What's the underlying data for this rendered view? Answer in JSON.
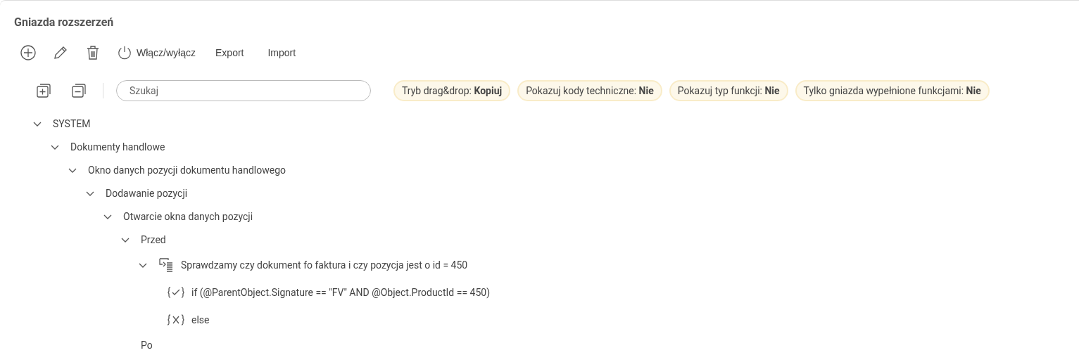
{
  "title": "Gniazda rozszerzeń",
  "toolbar": [
    {
      "kind": "add"
    },
    {
      "kind": "edit"
    },
    {
      "kind": "delete"
    },
    {
      "kind": "power",
      "label": "Włącz/wyłącz"
    },
    {
      "kind": "text",
      "label": "Export"
    },
    {
      "kind": "text",
      "label": "Import"
    }
  ],
  "search": {
    "placeholder": "Szukaj"
  },
  "filters": [
    "Tryb drag&drop: **Kopiuj**",
    "Pokazuj kody techniczne: **Nie**",
    "Pokazuj typ funkcji: **Nie**",
    "Tylko gniazda wypełnione funkcjami: **Nie**"
  ],
  "tree": [
    {
      "label": "SYSTEM",
      "expanded": true,
      "children": [
        {
          "label": "Dokumenty handlowe",
          "expanded": true,
          "children": [
            {
              "label": "Okno danych pozycji dokumentu handlowego",
              "expanded": true,
              "children": [
                {
                  "label": "Dodawanie pozycji",
                  "expanded": true,
                  "children": [
                    {
                      "label": "Otwarcie okna danych pozycji",
                      "expanded": true,
                      "children": [
                        {
                          "label": "Przed",
                          "expanded": true,
                          "children": [
                            {
                              "label": "Sprawdzamy czy dokument fo faktura i czy pozycja jest o id = 450",
                              "kind": "function",
                              "expanded": true,
                              "children": [
                                {
                                  "label": "if (@ParentObject.Signature == \"FV\" AND @Object.ProductId == 450)",
                                  "kind": "if"
                                },
                                {
                                  "label": "else",
                                  "kind": "else"
                                }
                              ]
                            }
                          ]
                        },
                        {
                          "label": "Po"
                        }
                      ]
                    }
                  ]
                }
              ]
            }
          ]
        }
      ]
    }
  ]
}
